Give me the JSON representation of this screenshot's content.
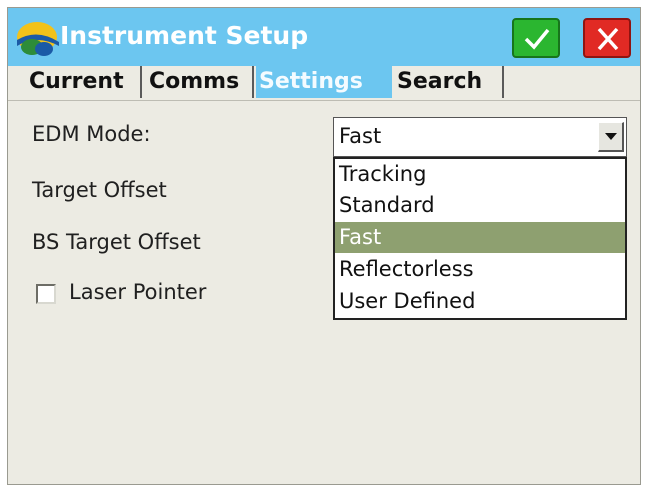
{
  "window": {
    "title": "Instrument Setup",
    "ok_icon": "checkmark-icon",
    "cancel_icon": "close-icon",
    "accent": "#6cc6f0",
    "ok_color": "#2bb630",
    "cancel_color": "#e12a24"
  },
  "tabs": [
    {
      "label": "Current",
      "active": false
    },
    {
      "label": "Comms",
      "active": false
    },
    {
      "label": "Settings",
      "active": true
    },
    {
      "label": "Search",
      "active": false
    }
  ],
  "form": {
    "edm_mode_label": "EDM Mode:",
    "edm_mode_value": "Fast",
    "target_offset_label": "Target Offset",
    "bs_target_offset_label": "BS Target Offset",
    "laser_pointer_label": "Laser Pointer",
    "laser_pointer_checked": false
  },
  "dropdown": {
    "options": [
      "Tracking",
      "Standard",
      "Fast",
      "Reflectorless",
      "User Defined"
    ],
    "selected": "Fast",
    "highlight_color": "#8ea070"
  }
}
